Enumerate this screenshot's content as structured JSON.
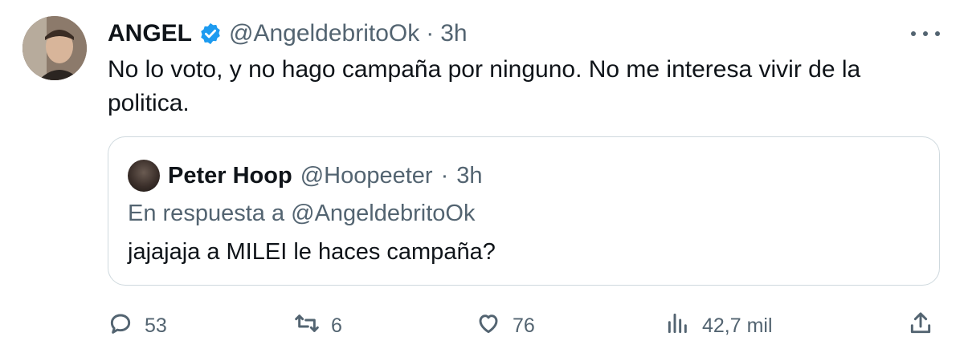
{
  "tweet": {
    "author_name": "ANGEL",
    "author_handle": "@AngeldebritoOk",
    "separator": "·",
    "time": "3h",
    "text": "No lo voto, y no hago campaña por ninguno. No me interesa vivir de la politica.",
    "verified": true
  },
  "quote": {
    "author_name": "Peter Hoop",
    "author_handle": "@Hoopeeter",
    "separator": "·",
    "time": "3h",
    "reply_to": "En respuesta a @AngeldebritoOk",
    "text": "jajajaja a MILEI le haces campaña?"
  },
  "actions": {
    "replies": "53",
    "retweets": "6",
    "likes": "76",
    "views": "42,7 mil"
  },
  "colors": {
    "text": "#0f1419",
    "muted": "#536471",
    "verified": "#1d9bf0",
    "border": "#cfd9de"
  },
  "icons": [
    "more-icon",
    "verified-badge-icon",
    "reply-icon",
    "retweet-icon",
    "like-icon",
    "views-icon",
    "share-icon"
  ]
}
